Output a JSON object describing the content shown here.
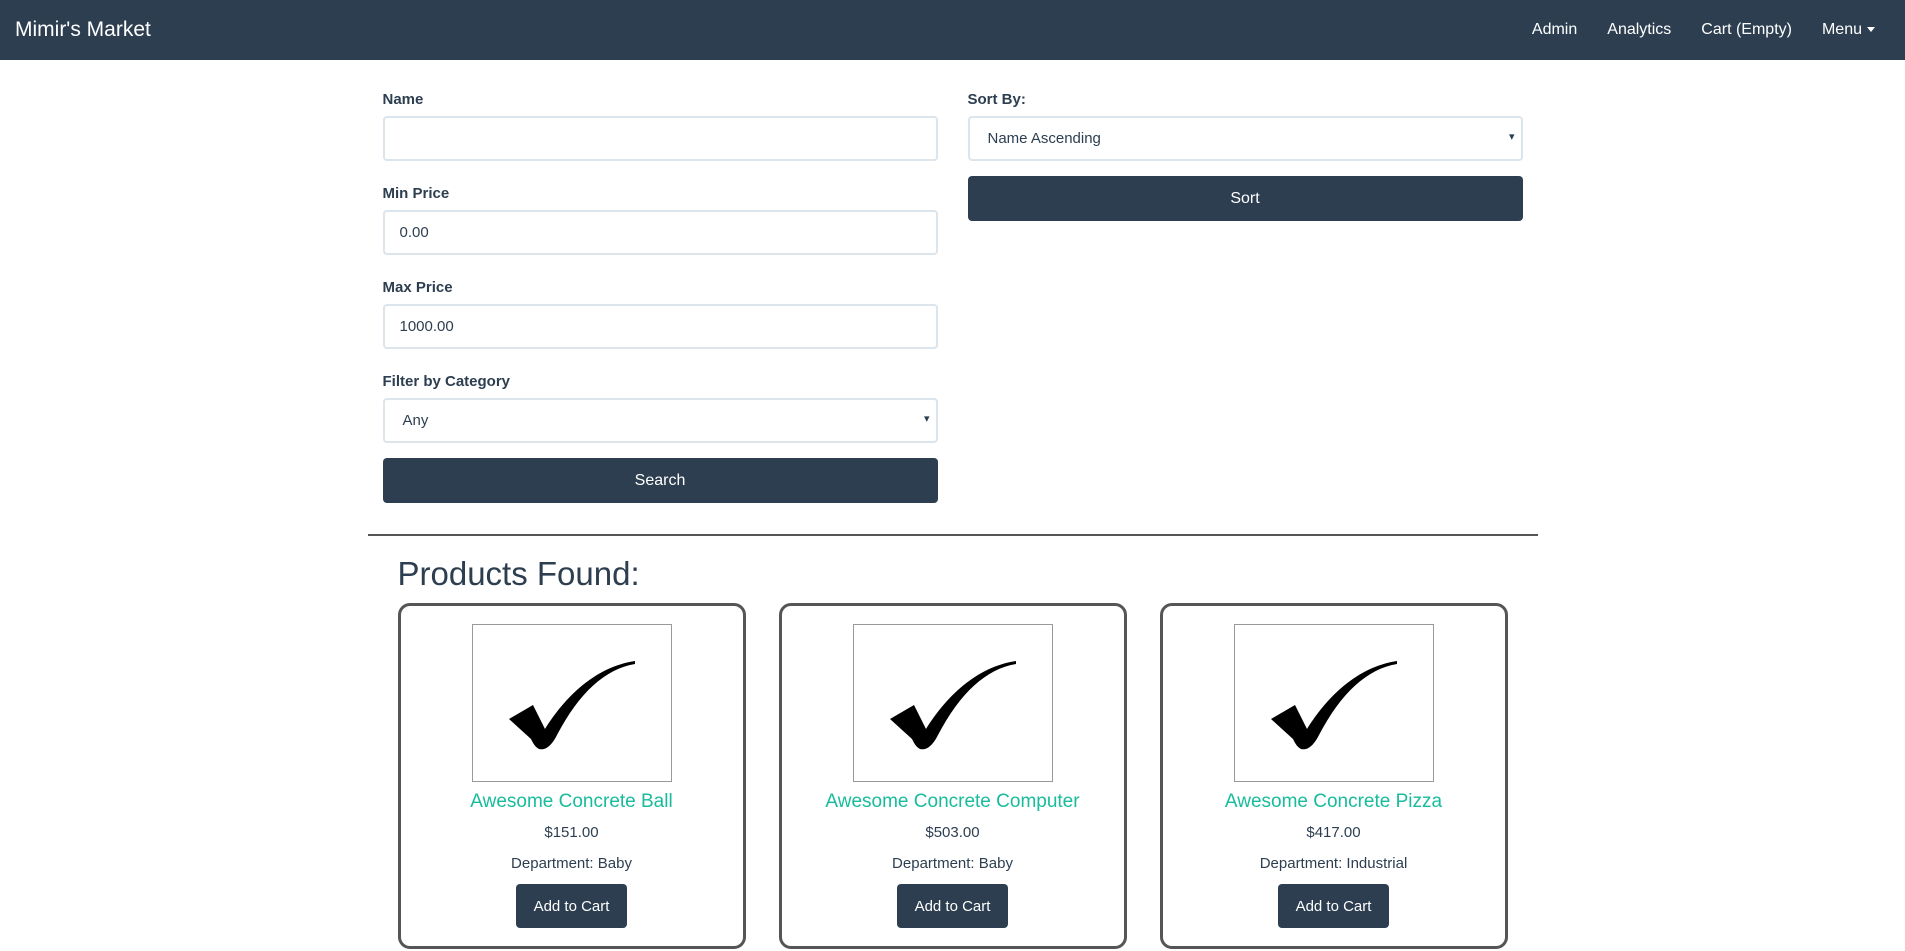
{
  "navbar": {
    "brand": "Mimir's Market",
    "links": [
      "Admin",
      "Analytics",
      "Cart (Empty)",
      "Menu"
    ]
  },
  "search": {
    "name_label": "Name",
    "name_value": "",
    "min_price_label": "Min Price",
    "min_price_value": "0.00",
    "max_price_label": "Max Price",
    "max_price_value": "1000.00",
    "category_label": "Filter by Category",
    "category_selected": "Any",
    "search_button": "Search"
  },
  "sort": {
    "label": "Sort By:",
    "selected": "Name Ascending",
    "button": "Sort"
  },
  "products": {
    "heading": "Products Found:",
    "add_to_cart_label": "Add to Cart",
    "items": [
      {
        "name": "Awesome Concrete Ball",
        "price": "$151.00",
        "department": "Department: Baby",
        "icon": "checkmark-icon"
      },
      {
        "name": "Awesome Concrete Computer",
        "price": "$503.00",
        "department": "Department: Baby",
        "icon": "checkmark-icon"
      },
      {
        "name": "Awesome Concrete Pizza",
        "price": "$417.00",
        "department": "Department: Industrial",
        "icon": "checkmark-icon"
      }
    ]
  },
  "colors": {
    "navbar_bg": "#2c3e50",
    "primary_button": "#2c3e50",
    "link_accent": "#18bc9c"
  }
}
